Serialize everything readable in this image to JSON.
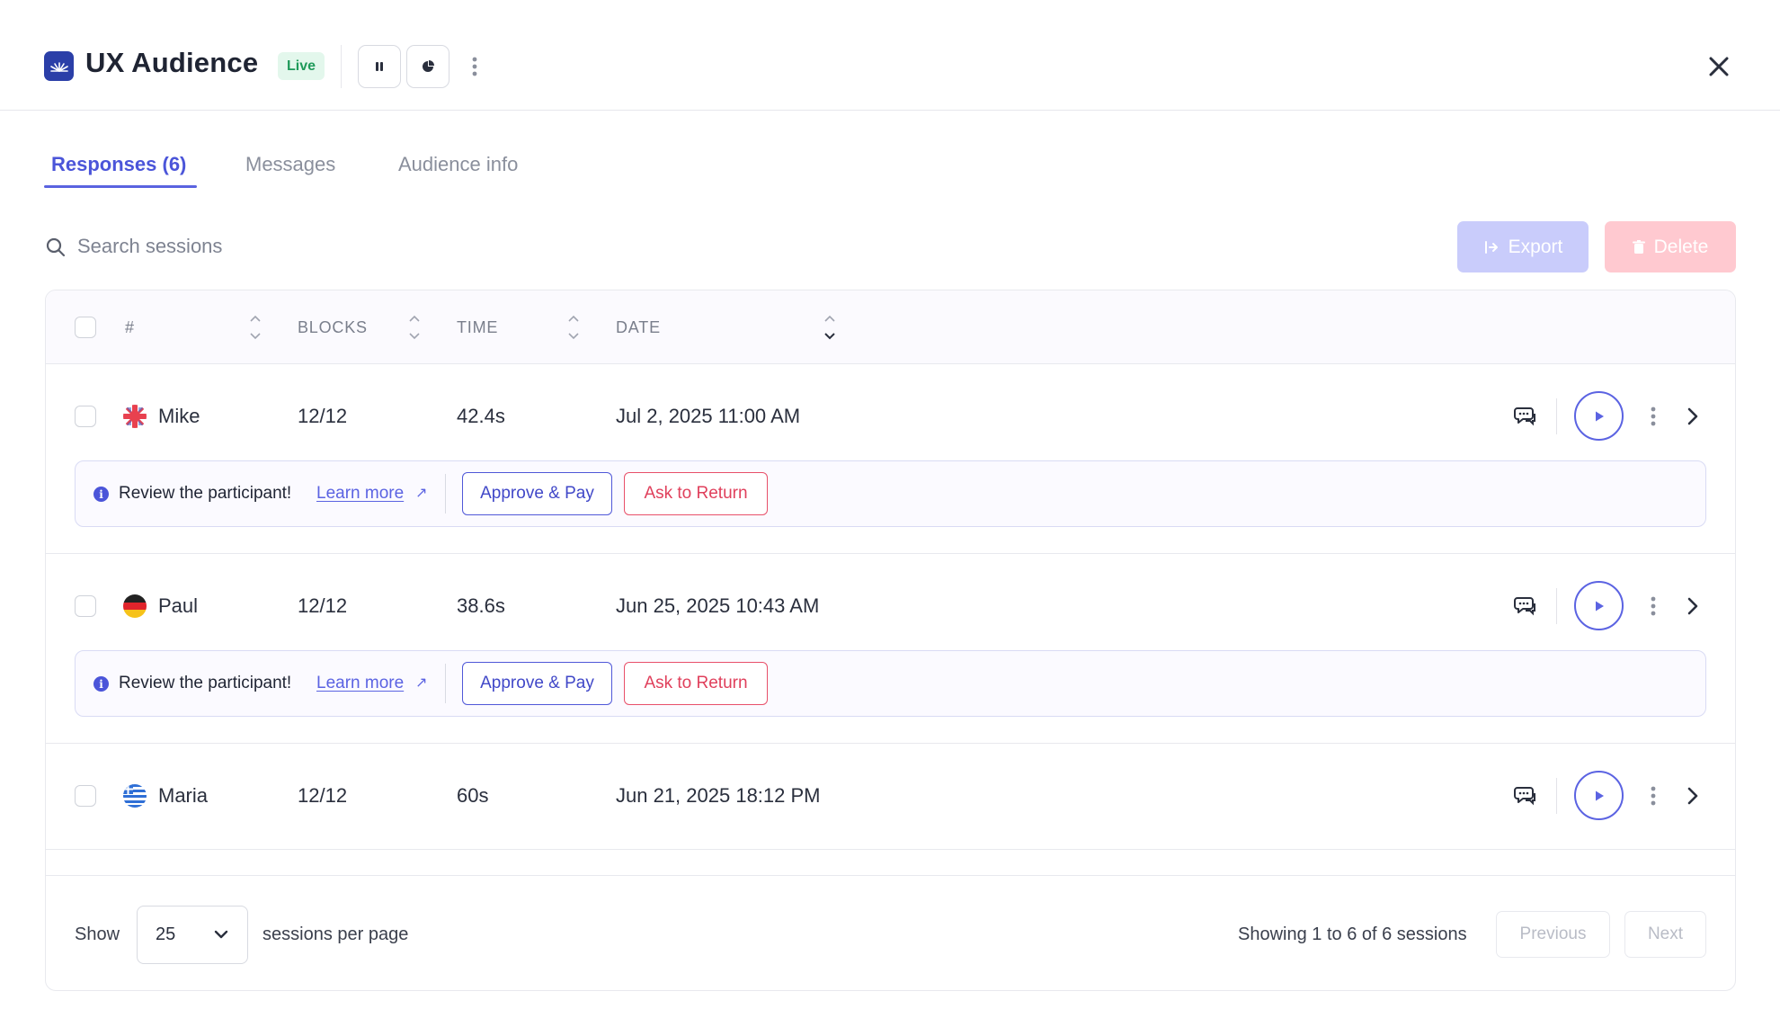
{
  "header": {
    "title": "UX Audience",
    "status_badge": "Live",
    "logo_icon": "audience-logo-icon",
    "accent_color": "#2b3fa8"
  },
  "tabs": [
    {
      "label": "Responses (6)",
      "active": true
    },
    {
      "label": "Messages",
      "active": false
    },
    {
      "label": "Audience info",
      "active": false
    }
  ],
  "search": {
    "placeholder": "Search sessions",
    "value": ""
  },
  "actions": {
    "export_label": "Export",
    "delete_label": "Delete"
  },
  "table": {
    "columns": [
      "#",
      "BLOCKS",
      "TIME",
      "DATE"
    ],
    "rows": [
      {
        "name": "Mike",
        "flag": "uk-flag-icon",
        "blocks": "12/12",
        "time": "42.4s",
        "date": "Jul 2, 2025 11:00 AM",
        "review": true
      },
      {
        "name": "Paul",
        "flag": "germany-flag-icon",
        "blocks": "12/12",
        "time": "38.6s",
        "date": "Jun 25, 2025 10:43 AM",
        "review": true
      },
      {
        "name": "Maria",
        "flag": "greece-flag-icon",
        "blocks": "12/12",
        "time": "60s",
        "date": "Jun 21, 2025 18:12 PM",
        "review": false
      }
    ],
    "review": {
      "text": "Review the participant!",
      "learn_more": "Learn more",
      "approve_label": "Approve & Pay",
      "return_label": "Ask to Return"
    }
  },
  "footer": {
    "show_label": "Show",
    "page_size": "25",
    "per_page_label": "sessions per page",
    "showing_text": "Showing 1 to 6 of 6 sessions",
    "previous_label": "Previous",
    "next_label": "Next"
  }
}
